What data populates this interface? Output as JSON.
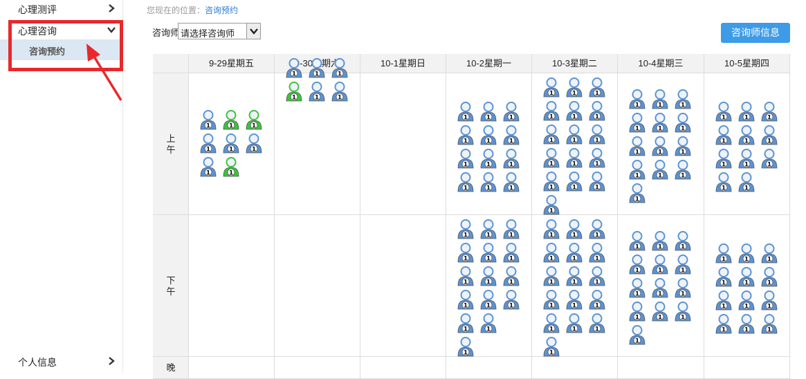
{
  "sidebar": {
    "items": [
      {
        "label": "心理测评"
      },
      {
        "label": "心理咨询"
      },
      {
        "label": "咨询预约"
      },
      {
        "label": "个人信息"
      }
    ]
  },
  "breadcrumb": {
    "prefix": "您现在的位置：",
    "current": "咨询预约"
  },
  "filter": {
    "counselor_label": "咨询师",
    "counselor_value": "请选择咨询师"
  },
  "info_button": "咨询师信息",
  "colors": {
    "available": "#5b93d4",
    "booked": "#3ec23e",
    "unavailable": "#a9a9a9",
    "button": "#3d9be8",
    "highlight": "#e8282b"
  },
  "schedule": {
    "days": [
      "9-29星期五",
      "9-30星期六",
      "10-1星期日",
      "10-2星期一",
      "10-3星期二",
      "10-4星期三",
      "10-5星期四"
    ],
    "periods": [
      "上午",
      "下午",
      "晚"
    ],
    "slots": [
      [
        "bgg bbb bg",
        "bbb gbb",
        "",
        "bbb bbb bbb bbb",
        "bbb bbb bbb bbb bbb b",
        "bbb bbb bbb bbb b",
        "bbb bbb bbb bb"
      ],
      [
        "",
        "",
        "",
        "bbb bbb bbb bbb bb b",
        "bbb bbb bbb bbb bbb b",
        "bbb bbb bbb bbb b",
        "bbb bbb bbb bbb"
      ],
      [
        "",
        "",
        "",
        "",
        "",
        "",
        ""
      ]
    ]
  }
}
